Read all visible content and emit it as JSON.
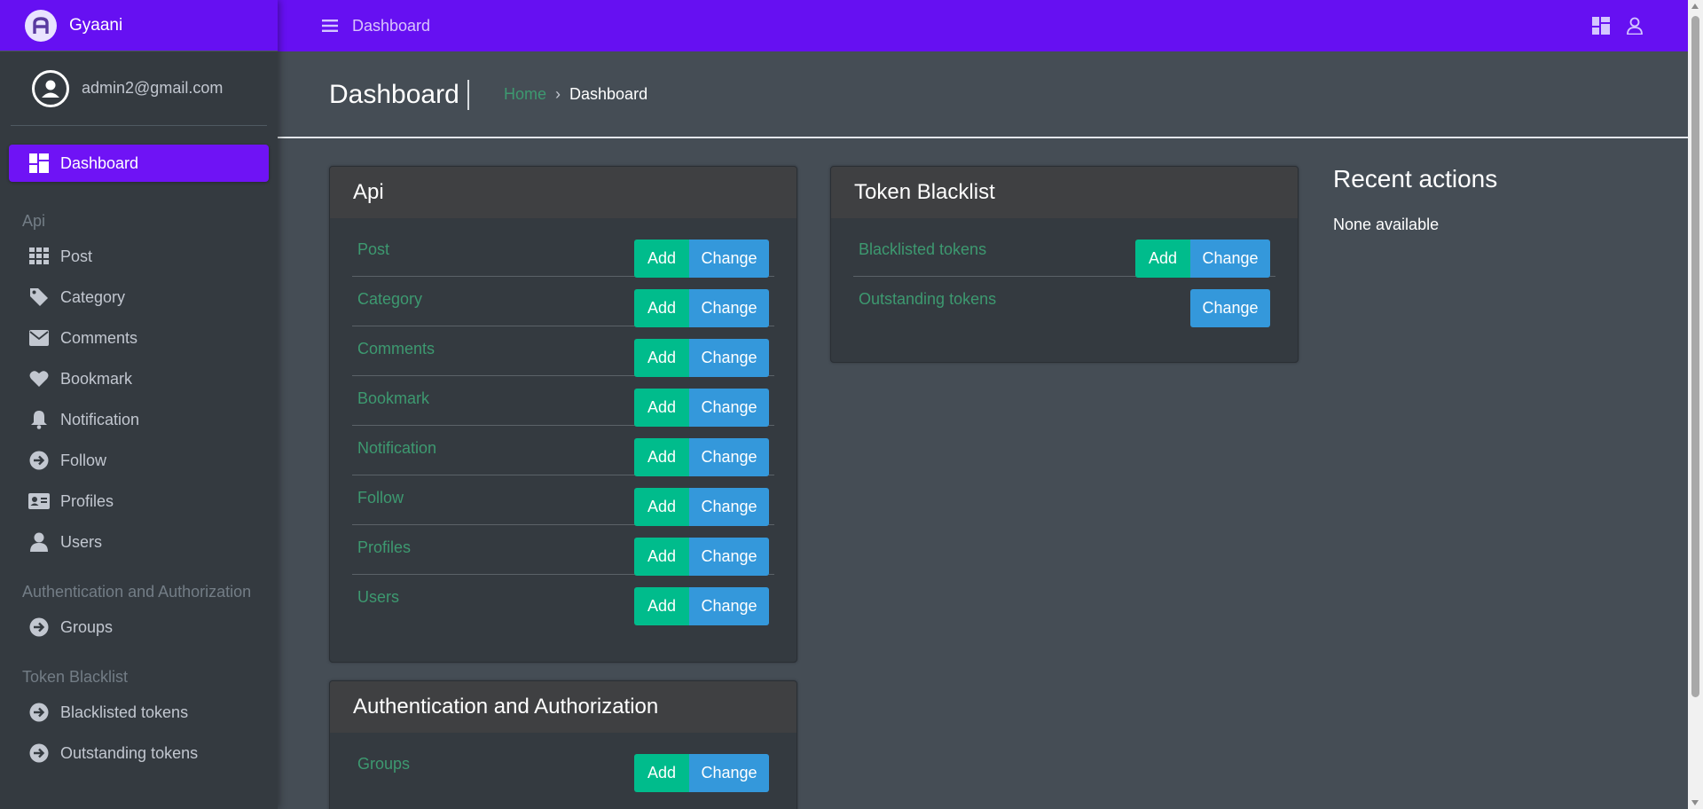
{
  "brand": {
    "title": "Gyaani",
    "logo_letter": "A",
    "color": "#6610f2"
  },
  "user": {
    "email": "admin2@gmail.com"
  },
  "sidebar": {
    "active": {
      "label": "Dashboard",
      "icon": "dashboard-grid-icon"
    },
    "sections": [
      {
        "header": "Api",
        "items": [
          {
            "label": "Post",
            "icon": "grid-icon"
          },
          {
            "label": "Category",
            "icon": "tag-icon"
          },
          {
            "label": "Comments",
            "icon": "envelope-icon"
          },
          {
            "label": "Bookmark",
            "icon": "heart-icon"
          },
          {
            "label": "Notification",
            "icon": "bell-icon"
          },
          {
            "label": "Follow",
            "icon": "arrow-circle-icon"
          },
          {
            "label": "Profiles",
            "icon": "id-card-icon"
          },
          {
            "label": "Users",
            "icon": "user-icon"
          }
        ]
      },
      {
        "header": "Authentication and Authorization",
        "items": [
          {
            "label": "Groups",
            "icon": "arrow-circle-icon"
          }
        ]
      },
      {
        "header": "Token Blacklist",
        "items": [
          {
            "label": "Blacklisted tokens",
            "icon": "arrow-circle-icon"
          },
          {
            "label": "Outstanding tokens",
            "icon": "arrow-circle-icon"
          }
        ]
      }
    ]
  },
  "topbar": {
    "link": "Dashboard",
    "menu_icon": "hamburger-icon",
    "right_icons": [
      "layout-grid-icon",
      "user-outline-icon"
    ]
  },
  "header": {
    "title": "Dashboard",
    "breadcrumb": {
      "home": "Home",
      "separator": "›",
      "current": "Dashboard"
    }
  },
  "cards": {
    "api": {
      "title": "Api",
      "rows": [
        {
          "label": "Post",
          "add": "Add",
          "change": "Change"
        },
        {
          "label": "Category",
          "add": "Add",
          "change": "Change"
        },
        {
          "label": "Comments",
          "add": "Add",
          "change": "Change"
        },
        {
          "label": "Bookmark",
          "add": "Add",
          "change": "Change"
        },
        {
          "label": "Notification",
          "add": "Add",
          "change": "Change"
        },
        {
          "label": "Follow",
          "add": "Add",
          "change": "Change"
        },
        {
          "label": "Profiles",
          "add": "Add",
          "change": "Change"
        },
        {
          "label": "Users",
          "add": "Add",
          "change": "Change"
        }
      ]
    },
    "auth": {
      "title": "Authentication and Authorization",
      "rows": [
        {
          "label": "Groups",
          "add": "Add",
          "change": "Change"
        }
      ]
    },
    "token": {
      "title": "Token Blacklist",
      "rows": [
        {
          "label": "Blacklisted tokens",
          "add": "Add",
          "change": "Change"
        },
        {
          "label": "Outstanding tokens",
          "change": "Change"
        }
      ]
    }
  },
  "recent": {
    "title": "Recent actions",
    "empty": "None available"
  },
  "colors": {
    "accent": "#6610f2",
    "add": "#00bc8c",
    "change": "#3498db",
    "link": "#3d9970"
  }
}
